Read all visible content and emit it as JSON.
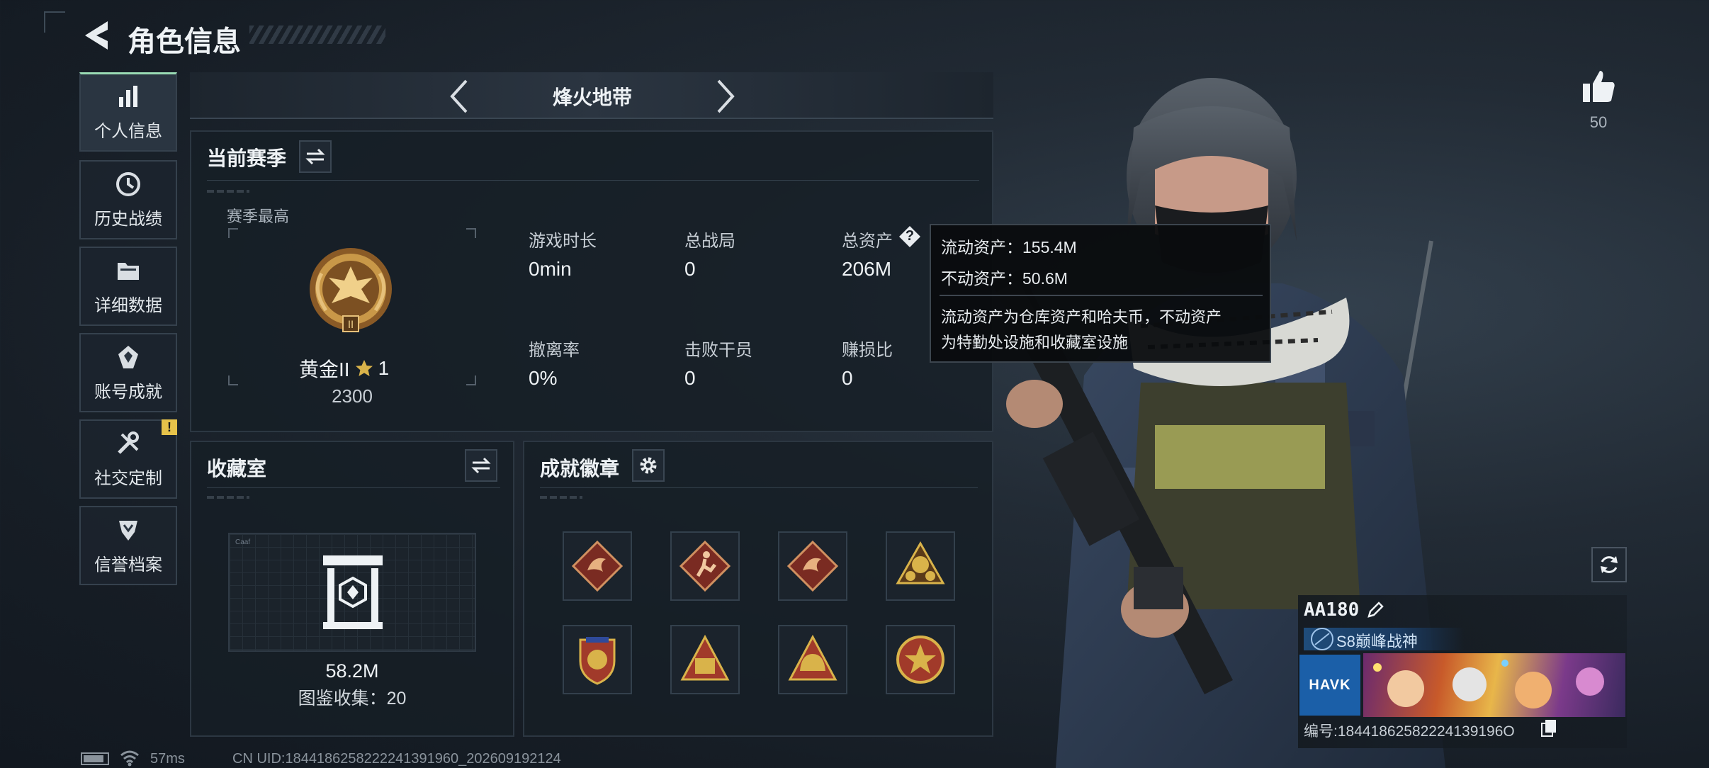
{
  "header": {
    "title": "角色信息"
  },
  "sidebar": {
    "items": [
      {
        "label": "个人信息",
        "icon": "bar-chart-icon",
        "active": true
      },
      {
        "label": "历史战绩",
        "icon": "clock-icon"
      },
      {
        "label": "详细数据",
        "icon": "folder-icon"
      },
      {
        "label": "账号成就",
        "icon": "achievement-icon"
      },
      {
        "label": "社交定制",
        "icon": "tools-icon",
        "alert": "!"
      },
      {
        "label": "信誉档案",
        "icon": "reputation-icon"
      }
    ]
  },
  "mode_selector": {
    "label": "烽火地带"
  },
  "season": {
    "title": "当前赛季",
    "best_label": "赛季最高",
    "rank_name": "黄金II",
    "rank_stars": "1",
    "rank_score": "2300",
    "stats": [
      {
        "label": "游戏时长",
        "value": "0min"
      },
      {
        "label": "总战局",
        "value": "0"
      },
      {
        "label": "总资产",
        "value": "206M"
      },
      {
        "label": "撤离率",
        "value": "0%"
      },
      {
        "label": "击败干员",
        "value": "0"
      },
      {
        "label": "赚损比",
        "value": "0"
      }
    ],
    "help_glyph": "?"
  },
  "tooltip": {
    "liquid": "流动资产：155.4M",
    "fixed": "不动资产：50.6M",
    "desc_line1": "流动资产为仓库资产和哈夫币，不动资产",
    "desc_line2": "为特勤处设施和收藏室设施"
  },
  "collection": {
    "title": "收藏室",
    "value": "58.2M",
    "count_text": "图鉴收集：20",
    "screen_caption": "Caaf"
  },
  "achievements": {
    "title": "成就徽章",
    "badges": [
      {
        "icon": "dragon-badge-icon",
        "color": "#7a2b22"
      },
      {
        "icon": "runner-badge-icon",
        "color": "#7a2b22"
      },
      {
        "icon": "dragon-badge-icon",
        "color": "#7a2b22"
      },
      {
        "icon": "star-medal-badge-icon",
        "color": "#b8862e"
      },
      {
        "icon": "shield-badge-icon",
        "color": "#a13a2a"
      },
      {
        "icon": "triangle-badge-icon",
        "color": "#b8862e"
      },
      {
        "icon": "helmet-badge-icon",
        "color": "#b8862e"
      },
      {
        "icon": "star-seal-badge-icon",
        "color": "#a13a2a"
      }
    ]
  },
  "likes": {
    "count": "50"
  },
  "player_card": {
    "name": "AA180",
    "title": "S8巅峰战神",
    "logo_text": "HAVK",
    "id_text": "编号:18441862582224139196O"
  },
  "status_bar": {
    "ping": "57ms",
    "uid": "CN UID:1844186258222241391960_202609192124"
  },
  "colors": {
    "accent": "#9adbb4",
    "gold": "#d9b34a",
    "alert": "#e6c24a"
  }
}
